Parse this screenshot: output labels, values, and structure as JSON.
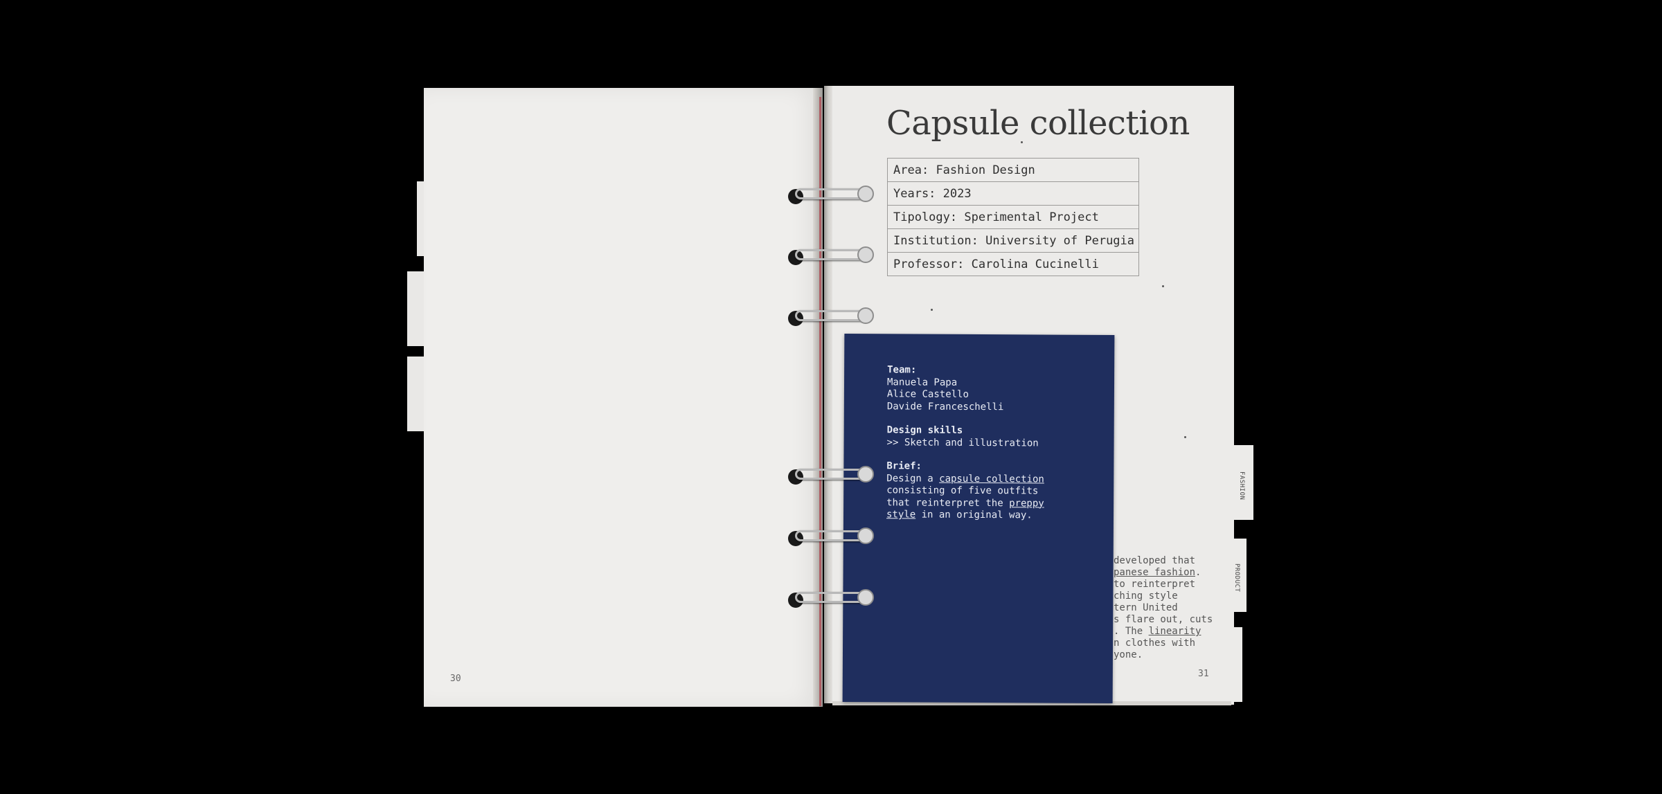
{
  "title": "Capsule collection",
  "info": [
    {
      "label": "Area:",
      "value": "Fashion Design"
    },
    {
      "label": "Years:",
      "value": "2023"
    },
    {
      "label": "Tipology:",
      "value": "Sperimental Project"
    },
    {
      "label": "Institution:",
      "value": "University of Perugia"
    },
    {
      "label": "Professor:",
      "value": "Carolina Cucinelli"
    }
  ],
  "card": {
    "team_heading": "Team:",
    "team": [
      "Manuela Papa",
      "Alice Castello",
      "Davide Franceschelli"
    ],
    "skills_heading": "Design skills",
    "skills": ">> Sketch and illustration",
    "brief_heading": "Brief:",
    "brief_line1_pre": "Design a ",
    "brief_line1_link": "capsule collection",
    "brief_line2": "consisting of five outfits",
    "brief_line3_pre": "that reinterpret the ",
    "brief_line3_link": "preppy",
    "brief_line4_link": "style",
    "brief_line4_post": " in an original way."
  },
  "peek_text": [
    {
      "pre": "developed that",
      "link": ""
    },
    {
      "pre": "",
      "link": "panese fashion",
      "post": "."
    },
    {
      "pre": "to reinterpret",
      "link": ""
    },
    {
      "pre": "ching style",
      "link": ""
    },
    {
      "pre": "tern United",
      "link": ""
    },
    {
      "pre": "s flare out, cuts",
      "link": ""
    },
    {
      "pre": ". The ",
      "link": "linearity"
    },
    {
      "pre": "n clothes with",
      "link": ""
    },
    {
      "pre": "yone.",
      "link": ""
    }
  ],
  "tabs": {
    "fashion": "FASHION",
    "product": "PRODUCT"
  },
  "page_numbers": {
    "left": "30",
    "right": "31"
  },
  "colors": {
    "background": "#000000",
    "paper": "#ecebe9",
    "card": "#1f2e5e"
  }
}
